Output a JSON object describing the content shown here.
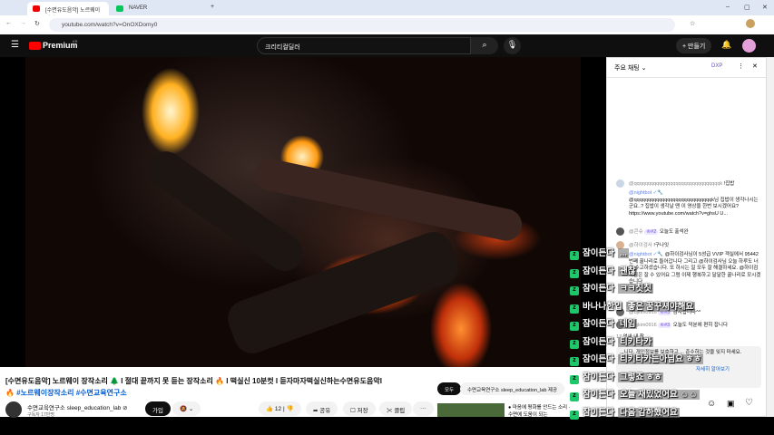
{
  "browser": {
    "tabs": [
      {
        "label": "[수면유도음악] 노르웨이 장작",
        "active": true,
        "color": "#e00"
      },
      {
        "label": "NAVER",
        "active": false,
        "color": "#03c75a"
      }
    ],
    "url": "youtube.com/watch?v=OnOXDomy0"
  },
  "header": {
    "logo": "Premium",
    "logo_sup": "KR",
    "search_value": "크리티컬딜러",
    "create_label": "+ 만들기"
  },
  "video": {
    "title": "[수면유도음악] 노르웨이 장작소리 🌲 I 절대 끝까지 못 듣는 장작소리 🔥 I 떡실신 10분컷 I 듣자마자떡실신하는수면유도음악I",
    "tags": "🔥 #노르웨이장작소리 #수면교육연구소",
    "channel": "수면교육연구소 sleep_education_lab ⊘",
    "subs": "구독자 17만명",
    "join_label": "가입",
    "like_count": "12",
    "share_label": "공유",
    "save_label": "저장",
    "clip_label": "클립",
    "more_label": "···"
  },
  "related": {
    "filter_all": "모두",
    "filter_channel": "수면교육연구소 sleep_education_lab 제공",
    "item_title": "● 마음에 평화를 안드는 소리 · 수면에 도움이 되는"
  },
  "chat": {
    "header": "주요 채팅 ⌄",
    "dxp": "DXP",
    "messages": [
      {
        "author": "@qqqqqqqqqqqqqqqqqqqqqqqqqqqqqqqk",
        "text": "!집밥"
      },
      {
        "author": "@nightbot ✓🔧",
        "text": "@qqqqqqqqqqqqqqqqqqqqqqqqqqqqk님 집밥이 생각나시는군요..? 집밥이 생각날 땐 이 영상을 한번 보시겠어요? https://www.youtube.com/watch?v=ghsU U..."
      },
      {
        "author": "@콘슈",
        "badge": "♔#2",
        "text": "오늘도 출석완"
      },
      {
        "author": "@하이검사",
        "text": "!구나잇"
      },
      {
        "author": "@nightbot ✓🔧",
        "text": "@하이검사님이 5성급 VVIP 객실에서 95442번째 꿀나리로 들어갑니다 그리고 @하이검사님 오늘 하루도 너무 수고하셨습니다. 또 하시는 일 모두 잘 해결하세요. @하이검사님은 잘 수 있어요 그럼 이제 행복하고 달달한 꿀나리로 모시겠습니다"
      },
      {
        "author": "@bjkim0916",
        "badge": "♔#3",
        "text": "감사합니다^^"
      },
      {
        "author": "@bjkim0916",
        "badge": "♔#3",
        "text": "오늘도 덕분에 편히 잡니다"
      },
      {
        "author": "17",
        "text": "엇싸 내 참"
      }
    ],
    "notice": "...니다. 개인정보를 보호하고 ... 준수하는 것을 잊지 마세요.",
    "notice_link": "자세히 알아보기"
  },
  "overlay": [
    {
      "user": "잠이든다",
      "text": "..."
    },
    {
      "user": "잠이든다",
      "text": "괜찮"
    },
    {
      "user": "잠이든다",
      "text": "ㅋㅋ칫칫"
    },
    {
      "user": "바나나한입",
      "text": "좋은 꿈꾸셔야해요"
    },
    {
      "user": "잠이든다",
      "text": "네임"
    },
    {
      "user": "잠이든다",
      "text": "티키타카"
    },
    {
      "user": "잠이든다",
      "text": "티키타카는아님요 ㅎㅎ"
    },
    {
      "user": "잠이든다",
      "text": "그렇죠 ㅎㅎ"
    },
    {
      "user": "잠이든다",
      "text": "오늘 재밌었어요 ☺☺"
    },
    {
      "user": "잠이든다",
      "text": "다음 감하했어요"
    }
  ]
}
